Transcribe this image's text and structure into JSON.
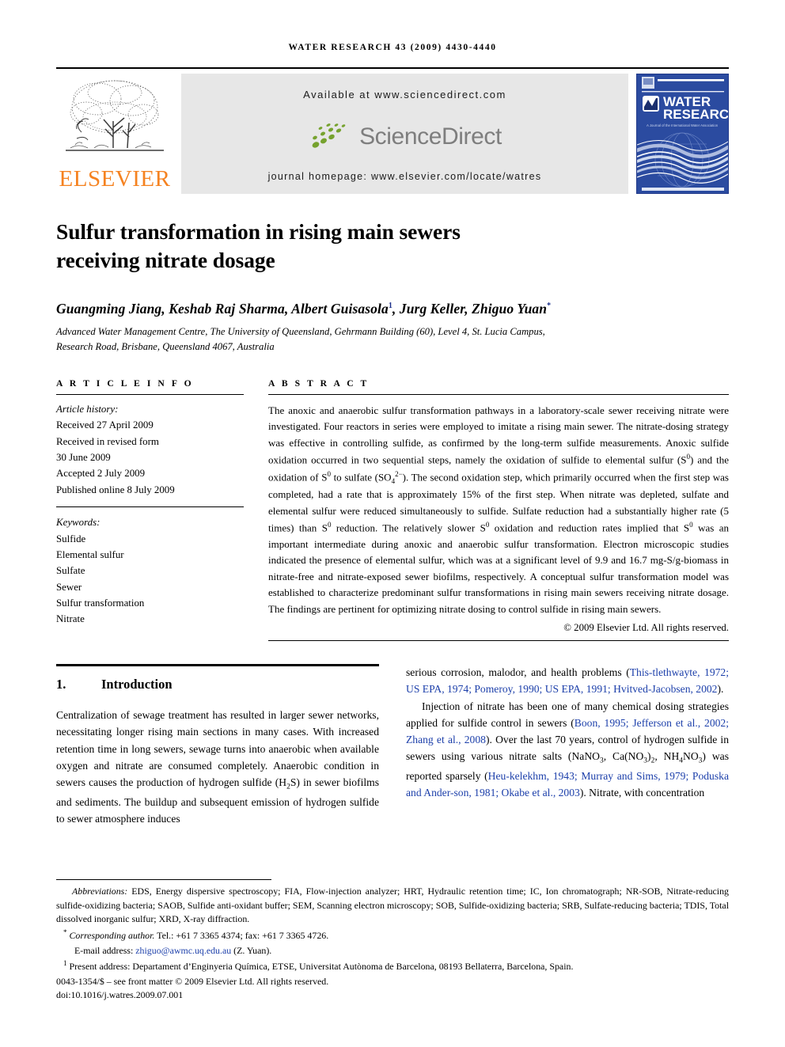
{
  "running_head": "WATER RESEARCH 43 (2009) 4430-4440",
  "masthead": {
    "publisher_name": "ELSEVIER",
    "available_at": "Available at www.sciencedirect.com",
    "sciencedirect_word": "ScienceDirect",
    "journal_homepage": "journal homepage: www.elsevier.com/locate/watres",
    "cover": {
      "line1": "WATER",
      "line2": "RESEARCH",
      "iwa_mark": "IWA",
      "tagline": "A Journal of the International Water Association"
    },
    "colors": {
      "elsevier_orange": "#F58220",
      "sciencedirect_green": "#76A22E",
      "sciencedirect_gray": "#7e7e7e",
      "panel_gray": "#e7e7e7",
      "cover_blue": "#2b4ba0",
      "link_blue": "#1c3faa"
    }
  },
  "article": {
    "title_line1": "Sulfur transformation in rising main sewers",
    "title_line2": "receiving nitrate dosage",
    "authors_pre": "Guangming Jiang, Keshab Raj Sharma, Albert Guisasola",
    "authors_sup1": "1",
    "authors_mid": ", Jurg Keller, Zhiguo Yuan",
    "authors_sup2": "*",
    "affiliation_line1": "Advanced Water Management Centre, The University of Queensland, Gehrmann Building (60), Level 4, St. Lucia Campus,",
    "affiliation_line2": "Research Road, Brisbane, Queensland 4067, Australia"
  },
  "article_info": {
    "heading": "A R T I C L E  I N F O",
    "history_label": "Article history:",
    "history": [
      "Received 27 April 2009",
      "Received in revised form",
      "30 June 2009",
      "Accepted 2 July 2009",
      "Published online 8 July 2009"
    ],
    "keywords_label": "Keywords:",
    "keywords": [
      "Sulfide",
      "Elemental sulfur",
      "Sulfate",
      "Sewer",
      "Sulfur transformation",
      "Nitrate"
    ]
  },
  "abstract": {
    "heading": "A B S T R A C T",
    "part1": "The anoxic and anaerobic sulfur transformation pathways in a laboratory-scale sewer receiving nitrate were investigated. Four reactors in series were employed to imitate a rising main sewer. The nitrate-dosing strategy was effective in controlling sulfide, as confirmed by the long-term sulfide measurements. Anoxic sulfide oxidation occurred in two sequential steps, namely the oxidation of sulfide to elemental sulfur (S",
    "sup_zero_a": "0",
    "part2": ") and the oxidation of S",
    "sup_zero_b": "0",
    "part3": " to sulfate (SO",
    "sub_four": "4",
    "sup_charge": "2−",
    "part4": "). The second oxidation step, which primarily occurred when the first step was completed, had a rate that is approximately 15% of the first step. When nitrate was depleted, sulfate and elemental sulfur were reduced simultaneously to sulfide. Sulfate reduction had a substantially higher rate (5 times) than S",
    "sup_zero_c": "0",
    "part5": " reduction. The relatively slower S",
    "sup_zero_d": "0",
    "part6": " oxidation and reduction rates implied that S",
    "sup_zero_e": "0",
    "part7": " was an important intermediate during anoxic and anaerobic sulfur transformation. Electron microscopic studies indicated the presence of elemental sulfur, which was at a significant level of 9.9 and 16.7 mg-S/g-biomass in nitrate-free and nitrate-exposed sewer biofilms, respectively. A conceptual sulfur transformation model was established to characterize predominant sulfur transformations in rising main sewers receiving nitrate dosage. The findings are pertinent for optimizing nitrate dosing to control sulfide in rising main sewers.",
    "copyright": "© 2009 Elsevier Ltd. All rights reserved."
  },
  "introduction": {
    "number": "1.",
    "title": "Introduction",
    "left_para_a": "Centralization of sewage treatment has resulted in larger sewer networks, necessitating longer rising main sections in many cases. With increased retention time in long sewers, sewage turns into anaerobic when available oxygen and nitrate are consumed completely. Anaerobic condition in sewers causes the production of hydrogen sulfide (H",
    "left_sub_2": "2",
    "left_para_b": "S) in sewer biofilms and sediments. The buildup and subsequent emission of hydrogen sulfide to sewer atmosphere induces",
    "right_para1_a": "serious corrosion, malodor, and health problems (",
    "right_cite1": "This-tlethwayte, 1972; US EPA, 1974; Pomeroy, 1990; US EPA, 1991; Hvitved-Jacobsen, 2002",
    "right_para1_b": ").",
    "right_para2_a": "Injection of nitrate has been one of many chemical dosing strategies applied for sulfide control in sewers (",
    "right_cite2": "Boon, 1995; Jefferson et al., 2002; Zhang et al., 2008",
    "right_para2_b": "). Over the last 70 years, control of hydrogen sulfide in sewers using various nitrate salts (NaNO",
    "sub_3a": "3",
    "right_para2_c": ", Ca(NO",
    "sub_3b": "3",
    "right_para2_d": ")",
    "sub_2": "2",
    "right_para2_e": ", NH",
    "sub_4": "4",
    "right_para2_f": "NO",
    "sub_3c": "3",
    "right_para2_g": ") was reported sparsely (",
    "right_cite3": "Heu-kelekhm, 1943; Murray and Sims, 1979; Poduska and Ander-son, 1981; Okabe et al., 2003",
    "right_para2_h": "). Nitrate, with concentration"
  },
  "footnotes": {
    "abbrev_label": "Abbreviations:",
    "abbrev_text": " EDS, Energy dispersive spectroscopy; FIA, Flow-injection analyzer; HRT, Hydraulic retention time; IC, Ion chromatograph; NR-SOB, Nitrate-reducing sulfide-oxidizing bacteria; SAOB, Sulfide anti-oxidant buffer; SEM, Scanning electron microscopy; SOB, Sulfide-oxidizing bacteria; SRB, Sulfate-reducing bacteria; TDIS, Total dissolved inorganic sulfur; XRD, X-ray diffraction.",
    "corresp_marker": "*",
    "corresp_label": "Corresponding author.",
    "corresp_text": " Tel.: +61 7 3365 4374; fax: +61 7 3365 4726.",
    "email_label": "E-mail address:",
    "email": "zhiguo@awmc.uq.edu.au",
    "email_suffix": " (Z. Yuan).",
    "present_marker": "1",
    "present_text": " Present address: Departament d’Enginyeria Química, ETSE, Universitat Autònoma de Barcelona, 08193 Bellaterra, Barcelona, Spain.",
    "front_matter": "0043-1354/$ – see front matter © 2009 Elsevier Ltd. All rights reserved.",
    "doi": "doi:10.1016/j.watres.2009.07.001"
  }
}
